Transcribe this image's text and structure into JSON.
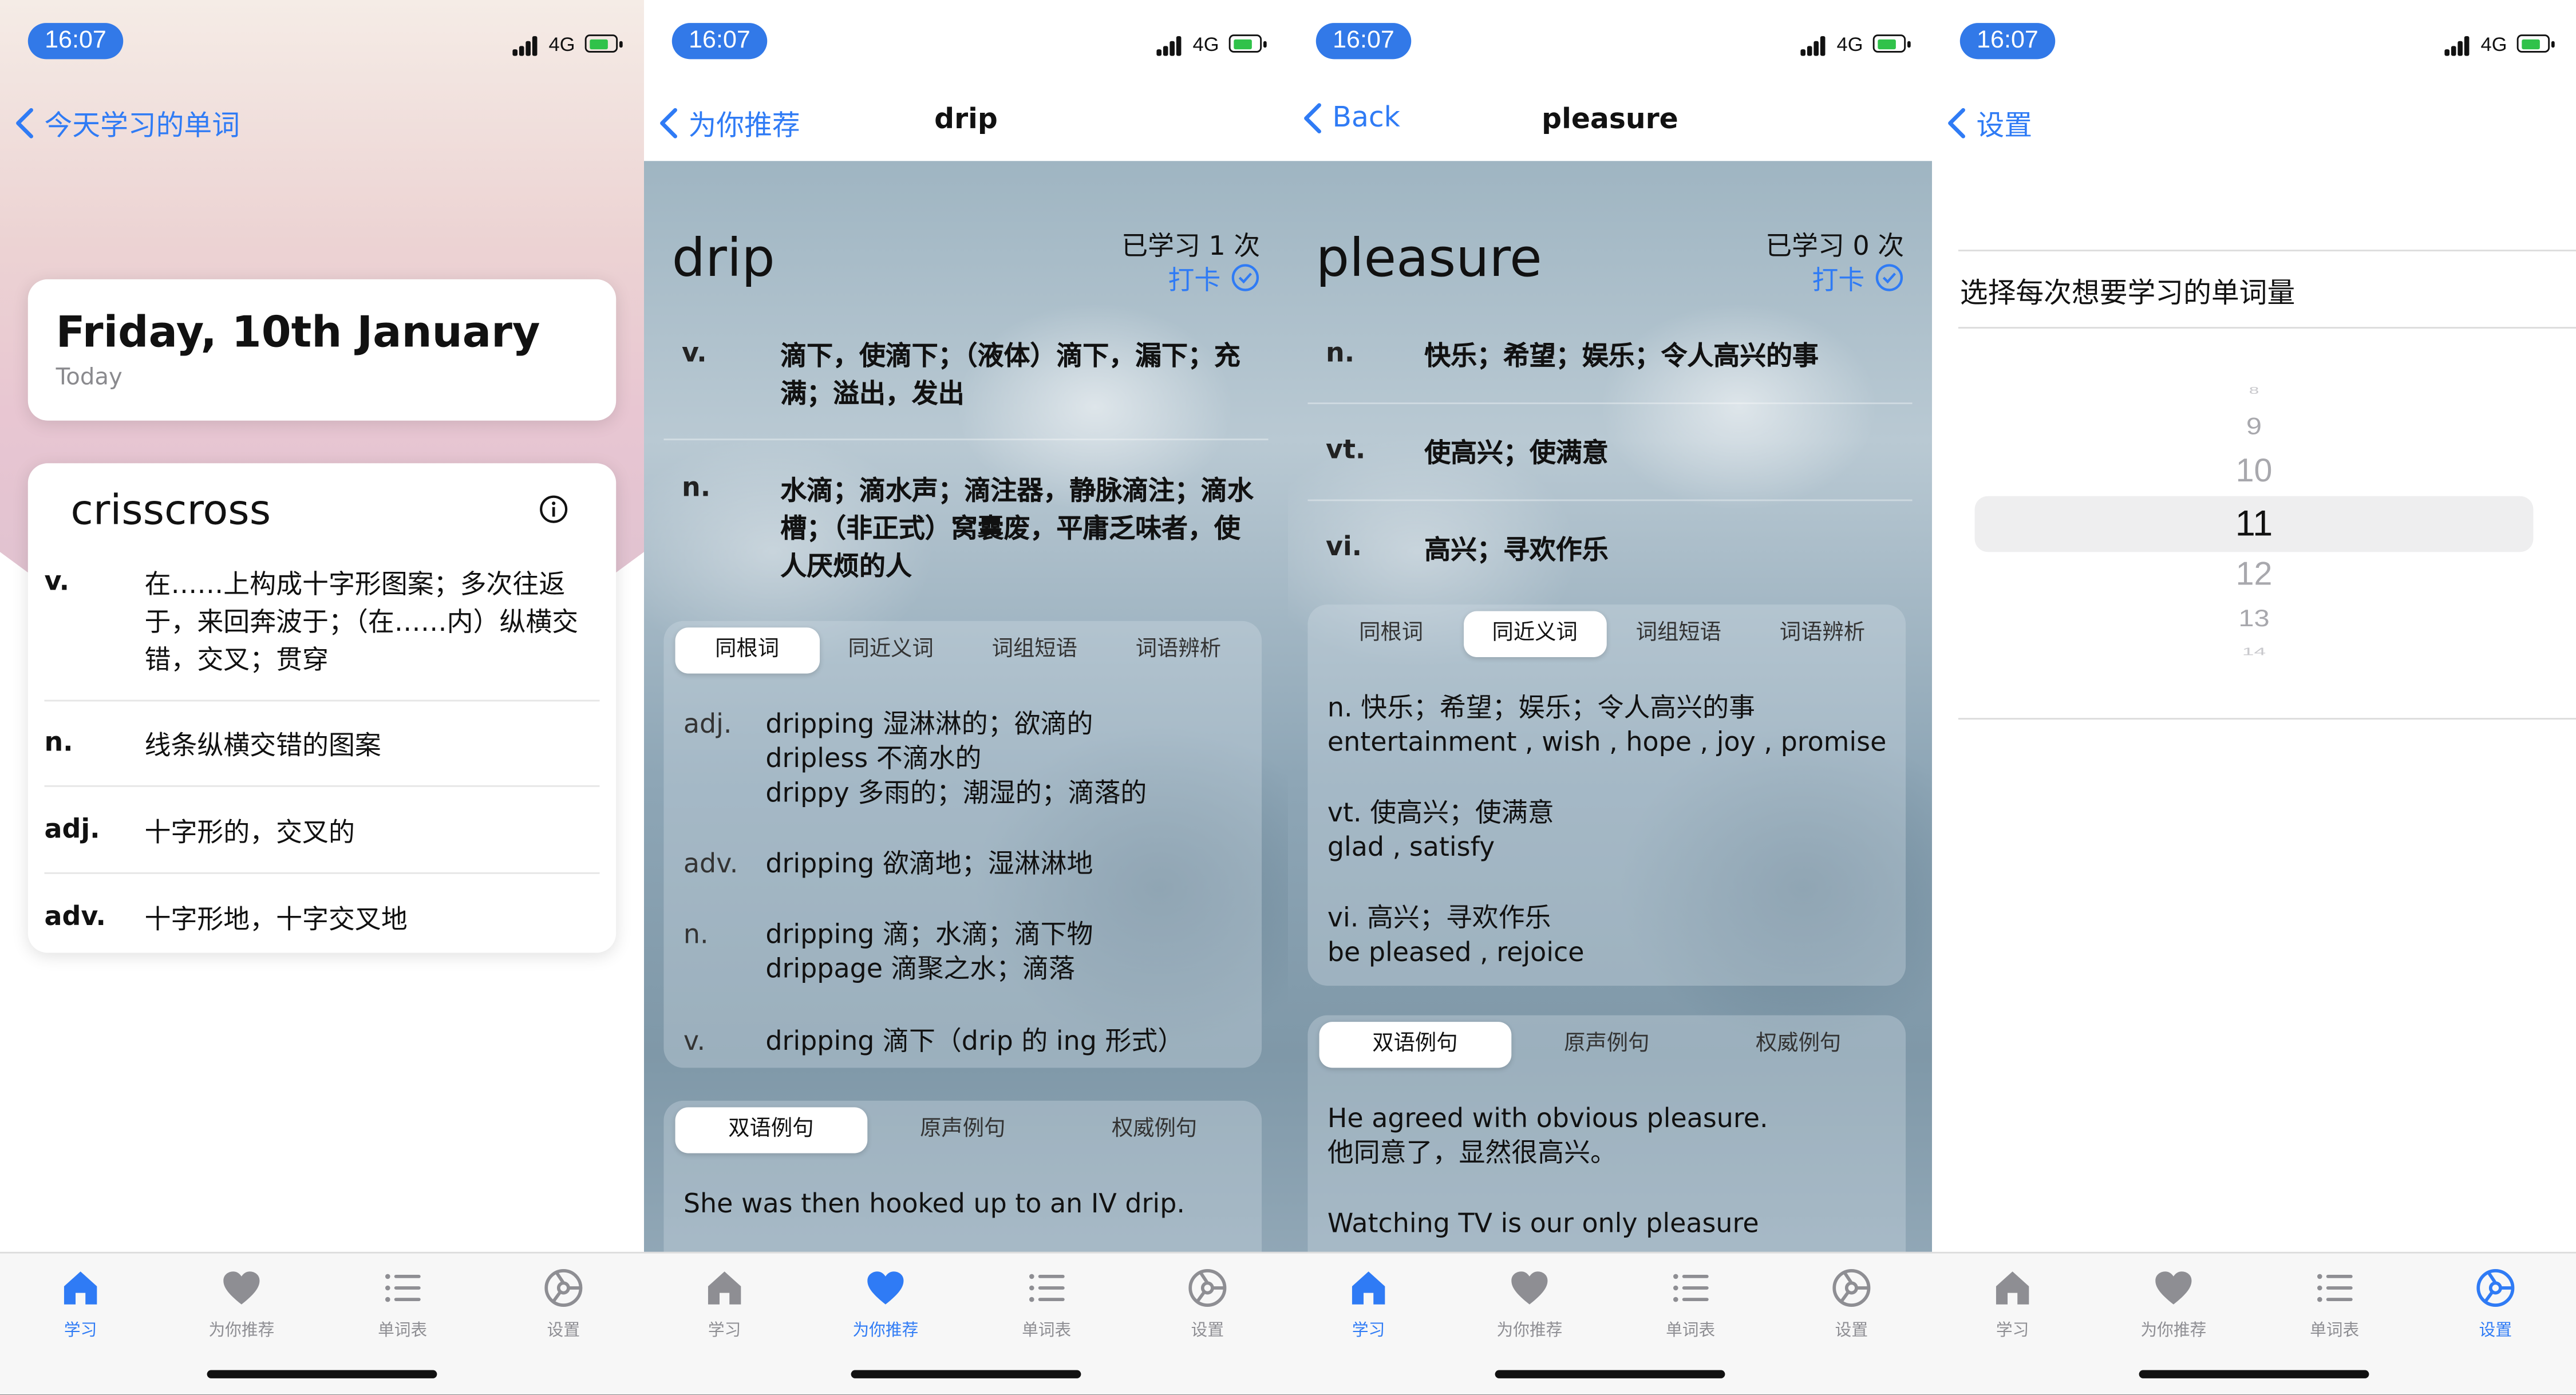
{
  "status": {
    "time": "16:07",
    "network": "4G"
  },
  "tabs": [
    "学习",
    "为你推荐",
    "单词表",
    "设置"
  ],
  "screen1": {
    "back": "今天学习的单词",
    "date": "Friday, 10th January",
    "today": "Today",
    "word": "crisscross",
    "defs": [
      {
        "pos": "v.",
        "text": "在……上构成十字形图案；多次往返于，来回奔波于；（在……内）纵横交错，交叉；贯穿"
      },
      {
        "pos": "n.",
        "text": "线条纵横交错的图案"
      },
      {
        "pos": "adj.",
        "text": "十字形的，交叉的"
      },
      {
        "pos": "adv.",
        "text": "十字形地，十字交叉地"
      }
    ]
  },
  "screen2": {
    "back": "为你推荐",
    "title": "drip",
    "word": "drip",
    "learned": "已学习 1 次",
    "checkin": "打卡",
    "defs": [
      {
        "pos": "v.",
        "text": "滴下，使滴下；（液体）滴下，漏下；充满；溢出，发出"
      },
      {
        "pos": "n.",
        "text": "水滴；滴水声；滴注器，静脉滴注；滴水槽；（非正式）窝囊废，平庸乏味者，使人厌烦的人"
      }
    ],
    "seg1": [
      "同根词",
      "同近义词",
      "词组短语",
      "词语辨析"
    ],
    "roots": [
      {
        "pos": "adj.",
        "lines": [
          "dripping 湿淋淋的；欲滴的",
          "dripless 不滴水的",
          "drippy 多雨的；潮湿的；滴落的"
        ]
      },
      {
        "pos": "adv.",
        "lines": [
          "dripping 欲滴地；湿淋淋地"
        ]
      },
      {
        "pos": "n.",
        "lines": [
          "dripping 滴；水滴；滴下物",
          "drippage 滴聚之水；滴落"
        ]
      },
      {
        "pos": "v.",
        "lines": [
          "dripping 滴下（drip 的 ing 形式）"
        ]
      }
    ],
    "seg2": [
      "双语例句",
      "原声例句",
      "权威例句"
    ],
    "example": "She was then hooked up to an IV drip."
  },
  "screen3": {
    "back": "Back",
    "title": "pleasure",
    "word": "pleasure",
    "learned": "已学习 0 次",
    "checkin": "打卡",
    "defs": [
      {
        "pos": "n.",
        "text": "快乐；希望；娱乐；令人高兴的事"
      },
      {
        "pos": "vt.",
        "text": "使高兴；使满意"
      },
      {
        "pos": "vi.",
        "text": "高兴；寻欢作乐"
      }
    ],
    "seg1": [
      "同根词",
      "同近义词",
      "词组短语",
      "词语辨析"
    ],
    "syn": [
      {
        "zh": "n. 快乐；希望；娱乐；令人高兴的事",
        "en": "entertainment , wish , hope , joy , promise"
      },
      {
        "zh": "vt. 使高兴；使满意",
        "en": "glad , satisfy"
      },
      {
        "zh": "vi. 高兴；寻欢作乐",
        "en": "be pleased , rejoice"
      }
    ],
    "seg2": [
      "双语例句",
      "原声例句",
      "权威例句"
    ],
    "example_en": "He agreed with obvious pleasure.",
    "example_zh": "他同意了，显然很高兴。",
    "example_next": "Watching TV is our only pleasure"
  },
  "screen4": {
    "back": "设置",
    "label": "选择每次想要学习的单词量",
    "picker": [
      "8",
      "9",
      "10",
      "11",
      "12",
      "13",
      "14"
    ],
    "selected": "11"
  },
  "colors": {
    "accent": "#2f7bf5",
    "statusPill": "#3279e8"
  },
  "icons": [
    "home-icon",
    "heart-icon",
    "list-icon",
    "gear-icon",
    "chevron-left-icon",
    "info-icon",
    "checkmark-circle-icon"
  ]
}
